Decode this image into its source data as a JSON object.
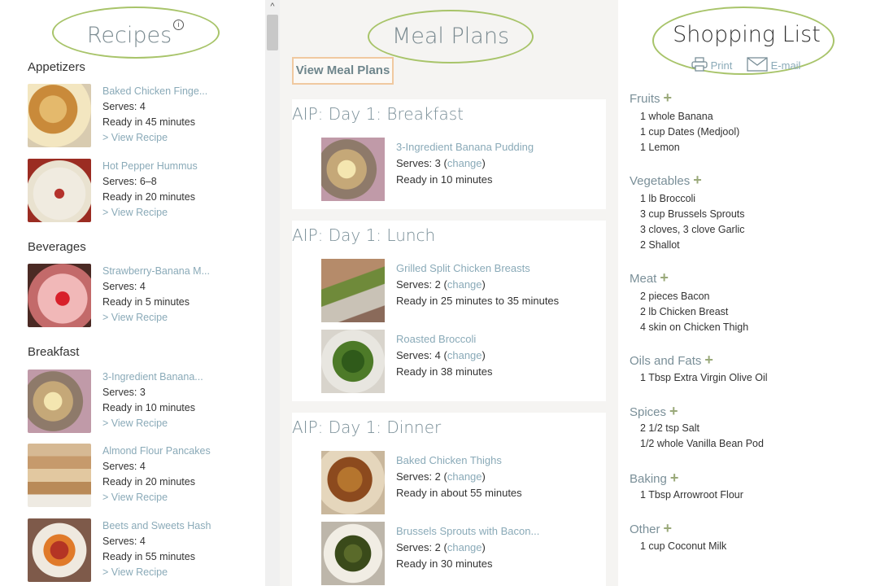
{
  "recipes": {
    "title": "Recipes",
    "info_icon": "i",
    "categories": [
      {
        "name": "Appetizers",
        "items": [
          {
            "name": "Baked Chicken Finge...",
            "serves": "Serves: 4",
            "ready": "Ready in 45 minutes",
            "link": "> View Recipe",
            "icon": "chicken-fingers-thumbnail"
          },
          {
            "name": "Hot Pepper Hummus",
            "serves": "Serves: 6–8",
            "ready": "Ready in 20 minutes",
            "link": "> View Recipe",
            "icon": "hummus-thumbnail"
          }
        ]
      },
      {
        "name": "Beverages",
        "items": [
          {
            "name": "Strawberry-Banana M...",
            "serves": "Serves: 4",
            "ready": "Ready in 5 minutes",
            "link": "> View Recipe",
            "icon": "smoothie-thumbnail"
          }
        ]
      },
      {
        "name": "Breakfast",
        "items": [
          {
            "name": "3-Ingredient Banana...",
            "serves": "Serves: 3",
            "ready": "Ready in 10 minutes",
            "link": "> View Recipe",
            "icon": "banana-pudding-thumbnail"
          },
          {
            "name": "Almond Flour Pancakes",
            "serves": "Serves: 4",
            "ready": "Ready in 20 minutes",
            "link": "> View Recipe",
            "icon": "pancakes-thumbnail"
          },
          {
            "name": "Beets and Sweets Hash",
            "serves": "Serves: 4",
            "ready": "Ready in 55 minutes",
            "link": "> View Recipe",
            "icon": "beets-hash-thumbnail"
          }
        ]
      }
    ]
  },
  "scrollbar": {
    "up_arrow": "^"
  },
  "meal_plans": {
    "title": "Meal Plans",
    "view_button": "View Meal Plans",
    "days": [
      {
        "title": "AIP: Day 1: Breakfast",
        "meals": [
          {
            "name": "3-Ingredient Banana Pudding",
            "serves_prefix": "Serves: 3 (",
            "change": "change",
            "serves_suffix": ")",
            "ready": "Ready in 10 minutes"
          }
        ]
      },
      {
        "title": "AIP: Day 1: Lunch",
        "meals": [
          {
            "name": "Grilled Split Chicken Breasts",
            "serves_prefix": "Serves: 2 (",
            "change": "change",
            "serves_suffix": ")",
            "ready": "Ready in 25 minutes to 35 minutes"
          },
          {
            "name": "Roasted Broccoli",
            "serves_prefix": "Serves: 4 (",
            "change": "change",
            "serves_suffix": ")",
            "ready": "Ready in 38 minutes"
          }
        ]
      },
      {
        "title": "AIP: Day 1: Dinner",
        "meals": [
          {
            "name": "Baked Chicken Thighs",
            "serves_prefix": "Serves: 2 (",
            "change": "change",
            "serves_suffix": ")",
            "ready": "Ready in about 55 minutes"
          },
          {
            "name": "Brussels Sprouts with Bacon...",
            "serves_prefix": "Serves: 2 (",
            "change": "change",
            "serves_suffix": ")",
            "ready": "Ready in 30 minutes"
          }
        ]
      }
    ]
  },
  "shopping_list": {
    "title": "Shopping List",
    "print_label": "Print",
    "email_label": "E-mail",
    "plus_symbol": "+",
    "categories": [
      {
        "name": "Fruits",
        "items": [
          "1 whole Banana",
          "1 cup Dates (Medjool)",
          "1 Lemon"
        ]
      },
      {
        "name": "Vegetables",
        "items": [
          "1 lb Broccoli",
          "3 cup Brussels Sprouts",
          "3 cloves, 3 clove Garlic",
          "2 Shallot"
        ]
      },
      {
        "name": "Meat",
        "items": [
          "2 pieces Bacon",
          "2 lb Chicken Breast",
          "4 skin on Chicken Thigh"
        ]
      },
      {
        "name": "Oils and Fats",
        "items": [
          "1 Tbsp Extra Virgin Olive Oil"
        ]
      },
      {
        "name": "Spices",
        "items": [
          "2 1/2 tsp Salt",
          "1/2 whole Vanilla Bean Pod"
        ]
      },
      {
        "name": "Baking",
        "items": [
          "1 Tbsp Arrowroot Flour"
        ]
      },
      {
        "name": "Other",
        "items": [
          "1 cup Coconut Milk"
        ]
      }
    ]
  },
  "colors": {
    "accent_link": "#8aaab8",
    "oval": "#a8c46a",
    "button_border": "#f0c9a0",
    "middle_bg": "#f5f4f2"
  }
}
